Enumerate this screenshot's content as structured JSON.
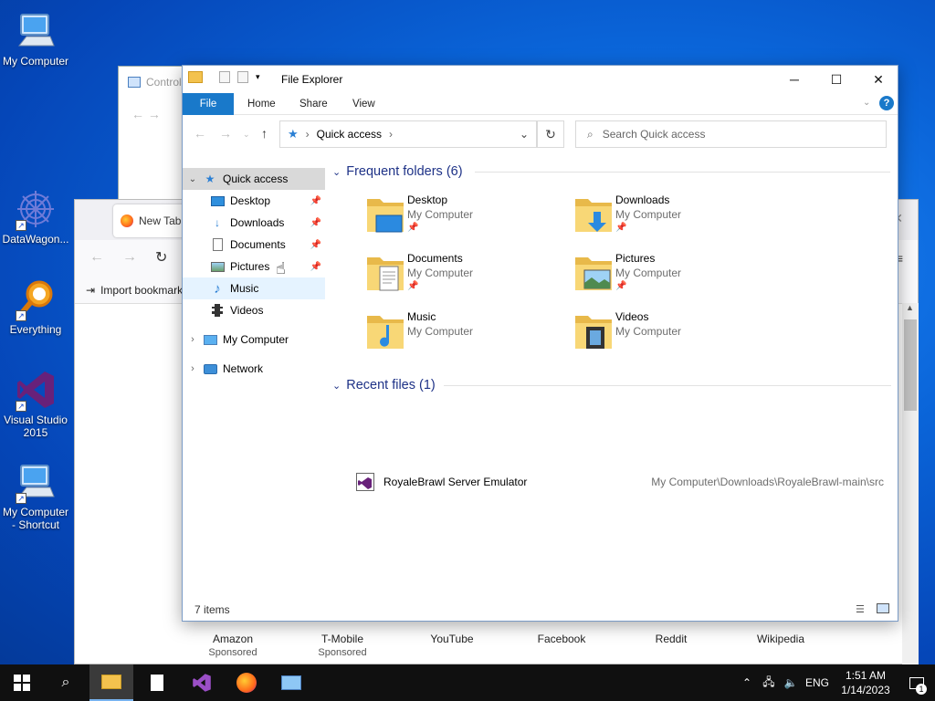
{
  "desktop": {
    "icons": [
      {
        "label": "My Computer",
        "icon": "computer-icon"
      },
      {
        "label": "DataWagon...",
        "icon": "datawagon-icon"
      },
      {
        "label": "Everything",
        "icon": "everything-search-icon"
      },
      {
        "label": "Visual Studio 2015",
        "icon": "visual-studio-icon"
      },
      {
        "label": "My Computer - Shortcut",
        "icon": "computer-icon"
      }
    ]
  },
  "control_panel": {
    "title": "Control"
  },
  "browser": {
    "tab_title": "New Tab",
    "bookmark_label": "Import bookmarks...",
    "shortcuts": [
      {
        "label": "Amazon",
        "sub": "Sponsored"
      },
      {
        "label": "T-Mobile",
        "sub": "Sponsored"
      },
      {
        "label": "YouTube",
        "sub": ""
      },
      {
        "label": "Facebook",
        "sub": ""
      },
      {
        "label": "Reddit",
        "sub": ""
      },
      {
        "label": "Wikipedia",
        "sub": ""
      }
    ]
  },
  "explorer": {
    "title": "File Explorer",
    "ribbon_tabs": {
      "file": "File",
      "home": "Home",
      "share": "Share",
      "view": "View"
    },
    "address": "Quick access",
    "search_placeholder": "Search Quick access",
    "nav": {
      "quick_access": "Quick access",
      "items": [
        {
          "label": "Desktop",
          "pinned": true
        },
        {
          "label": "Downloads",
          "pinned": true
        },
        {
          "label": "Documents",
          "pinned": true
        },
        {
          "label": "Pictures",
          "pinned": true
        },
        {
          "label": "Music",
          "pinned": false
        },
        {
          "label": "Videos",
          "pinned": false
        }
      ],
      "my_computer": "My Computer",
      "network": "Network"
    },
    "frequent_header": "Frequent folders (6)",
    "folders": [
      {
        "name": "Desktop",
        "location": "My Computer",
        "pinned": true
      },
      {
        "name": "Downloads",
        "location": "My Computer",
        "pinned": true
      },
      {
        "name": "Documents",
        "location": "My Computer",
        "pinned": true
      },
      {
        "name": "Pictures",
        "location": "My Computer",
        "pinned": true
      },
      {
        "name": "Music",
        "location": "My Computer",
        "pinned": false
      },
      {
        "name": "Videos",
        "location": "My Computer",
        "pinned": false
      }
    ],
    "recent_header": "Recent files (1)",
    "recent": [
      {
        "name": "RoyaleBrawl Server Emulator",
        "path": "My Computer\\Downloads\\RoyaleBrawl-main\\src"
      }
    ],
    "status": "7 items"
  },
  "taskbar": {
    "language": "ENG",
    "time": "1:51 AM",
    "date": "1/14/2023",
    "notification_count": "1"
  },
  "colors": {
    "accent": "#1979ca",
    "group_header": "#1e3287",
    "taskbar": "#101010"
  }
}
